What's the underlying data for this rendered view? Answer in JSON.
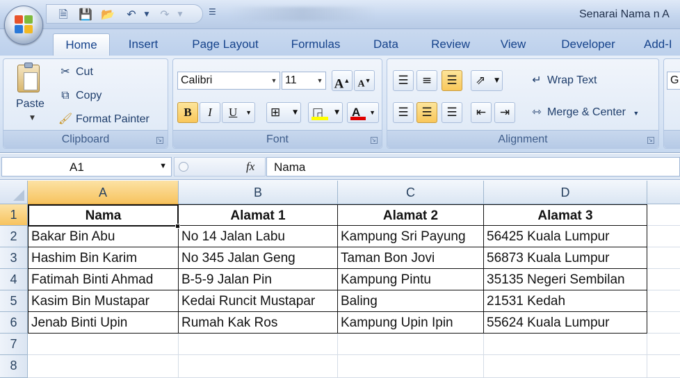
{
  "window": {
    "title": "Senarai Nama n A"
  },
  "tabs": [
    "Home",
    "Insert",
    "Page Layout",
    "Formulas",
    "Data",
    "Review",
    "View",
    "Developer",
    "Add-I"
  ],
  "clipboard": {
    "paste": "Paste",
    "cut": "Cut",
    "copy": "Copy",
    "format_painter": "Format Painter",
    "label": "Clipboard"
  },
  "font": {
    "name": "Calibri",
    "size": "11",
    "grow": "A",
    "shrink": "A",
    "bold": "B",
    "italic": "I",
    "underline": "U",
    "label": "Font"
  },
  "alignment": {
    "wrap_text": "Wrap Text",
    "merge_center": "Merge & Center",
    "label": "Alignment"
  },
  "number_partial": "G",
  "formula_bar": {
    "name_box": "A1",
    "fx": "fx",
    "value": "Nama"
  },
  "columns": [
    "A",
    "B",
    "C",
    "D"
  ],
  "rows": [
    "1",
    "2",
    "3",
    "4",
    "5",
    "6",
    "7",
    "8"
  ],
  "table": {
    "headers": [
      "Nama",
      "Alamat 1",
      "Alamat 2",
      "Alamat 3"
    ],
    "data": [
      [
        "Bakar Bin Abu",
        "No 14 Jalan Labu",
        "Kampung Sri Payung",
        "56425 Kuala Lumpur"
      ],
      [
        "Hashim Bin Karim",
        "No 345 Jalan Geng",
        "Taman Bon Jovi",
        "56873 Kuala Lumpur"
      ],
      [
        "Fatimah Binti Ahmad",
        "B-5-9 Jalan Pin",
        "Kampung Pintu",
        "35135 Negeri Sembilan"
      ],
      [
        "Kasim Bin Mustapar",
        "Kedai Runcit Mustapar",
        "Baling",
        "21531 Kedah"
      ],
      [
        "Jenab Binti Upin",
        "Rumah Kak Ros",
        "Kampung Upin Ipin",
        "55624 Kuala Lumpur"
      ]
    ]
  },
  "icons": {
    "office": "office-button-icon",
    "save": "save-icon",
    "open": "open-folder-icon",
    "undo": "undo-icon",
    "redo": "redo-icon",
    "new": "new-document-icon"
  },
  "colors": {
    "selection": "#f7c35f",
    "highlight_yellow": "#ffff00",
    "font_red": "#e00000"
  }
}
